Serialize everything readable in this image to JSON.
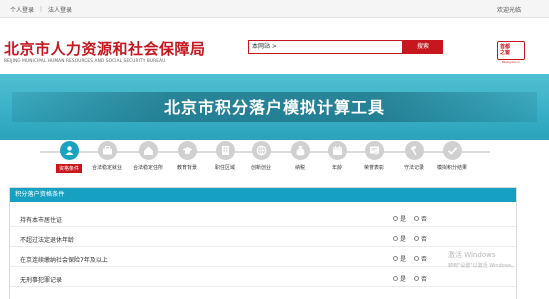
{
  "topbar": {
    "personal_login": "个人登录",
    "separator": "|",
    "corporate_login": "法人登录",
    "welcome": "欢迎光临"
  },
  "header": {
    "title": "北京市人力资源和社会保障局",
    "subtitle": "BEIJING MUNICIPAL HUMAN RESOURCES AND SOCIAL SECURITY BUREAU",
    "search_value": "本网站 >",
    "search_button": "搜索",
    "emblem_text_1": "首都",
    "emblem_text_2": "之窗",
    "emblem_sub": "Beijing.Gov.cn"
  },
  "banner": {
    "title": "北京市积分落户模拟计算工具"
  },
  "steps": [
    {
      "label": "资格条件",
      "icon": "person-icon",
      "active": true
    },
    {
      "label": "合法稳定就业",
      "icon": "briefcase-icon",
      "active": false
    },
    {
      "label": "合法稳定住所",
      "icon": "house-icon",
      "active": false
    },
    {
      "label": "教育背景",
      "icon": "graduation-cap-icon",
      "active": false
    },
    {
      "label": "职住区域",
      "icon": "building-icon",
      "active": false
    },
    {
      "label": "创新创业",
      "icon": "globe-icon",
      "active": false
    },
    {
      "label": "纳税",
      "icon": "money-bag-icon",
      "active": false
    },
    {
      "label": "年龄",
      "icon": "calendar-icon",
      "active": false
    },
    {
      "label": "荣誉表彰",
      "icon": "certificate-icon",
      "active": false
    },
    {
      "label": "守法记录",
      "icon": "gavel-icon",
      "active": false
    },
    {
      "label": "模拟积分结果",
      "icon": "check-icon",
      "active": false
    }
  ],
  "panel": {
    "title": "积分落户资格条件",
    "yes_label": "是",
    "no_label": "否",
    "questions": [
      "持有本市居住证",
      "不超过法定退休年龄",
      "在京连续缴纳社会保险7年及以上",
      "无刑事犯罪记录"
    ]
  },
  "watermark": {
    "line1": "激活 Windows",
    "line2": "转到\"设置\"以激活 Windows。"
  }
}
